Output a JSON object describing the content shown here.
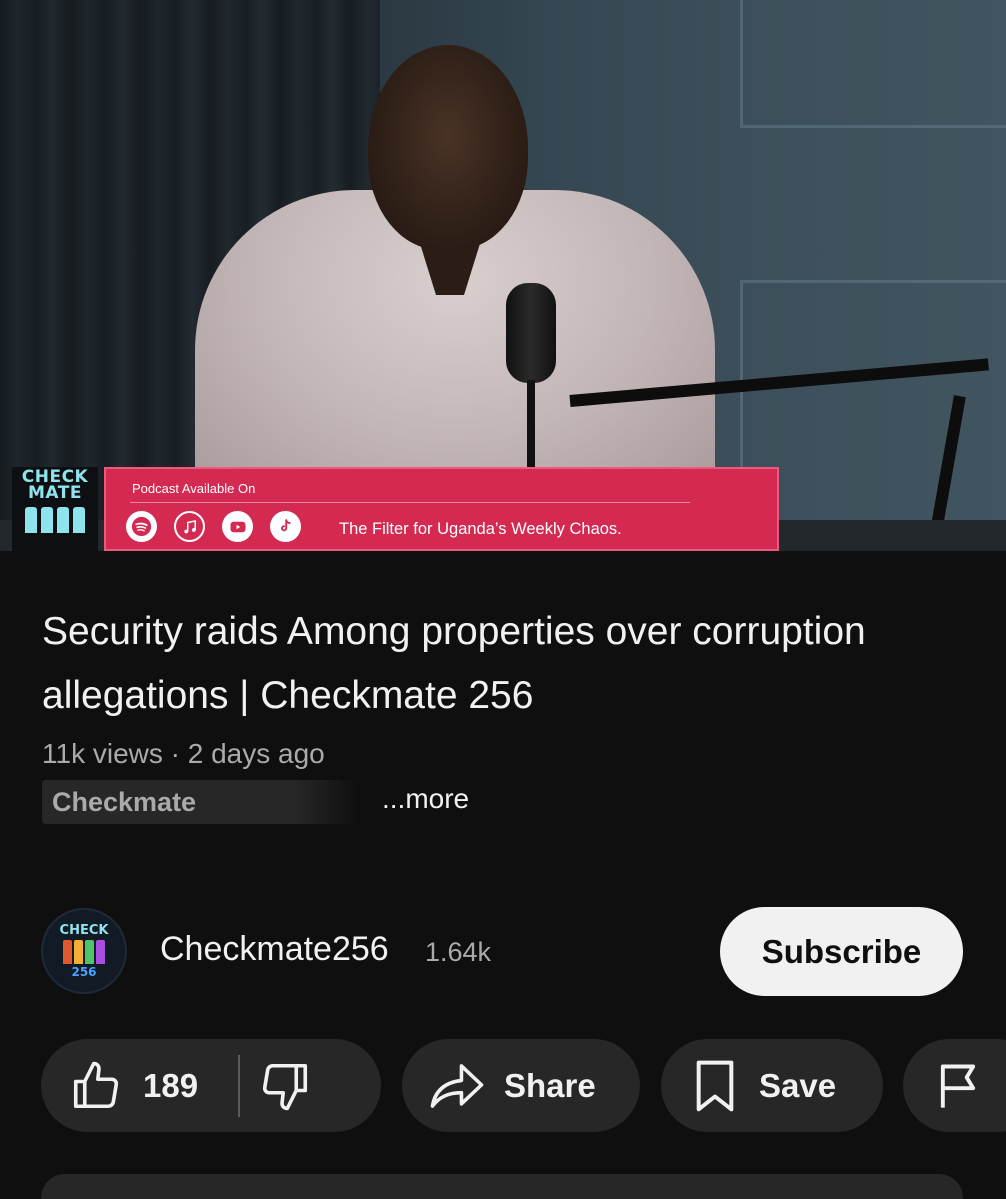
{
  "video": {
    "brand_text": "CHECK MATE",
    "podcast_label": "Podcast Available On",
    "podcast_tagline": "The Filter for Uganda’s Weekly Chaos.",
    "platform_icons": [
      "spotify-icon",
      "apple-podcasts-icon",
      "youtube-icon",
      "tiktok-icon"
    ]
  },
  "title": "Security raids Among properties over corruption allegations | Checkmate 256",
  "meta": {
    "views": "11k views",
    "separator": " · ",
    "age": "2 days ago"
  },
  "description_chip": "Checkmate",
  "more_label": "...more",
  "channel": {
    "avatar_text_top": "CHECK",
    "avatar_text_bottom": "256",
    "name": "Checkmate256",
    "subscribers": "1.64k",
    "subscribe_label": "Subscribe"
  },
  "actions": {
    "like_count": "189",
    "share_label": "Share",
    "save_label": "Save"
  },
  "colors": {
    "background": "#0f0f0f",
    "pill": "#272727",
    "podcast_bar": "#d42a52",
    "brand_cyan": "#8fe3ec",
    "subscribe_bg": "#f1f1f1"
  }
}
